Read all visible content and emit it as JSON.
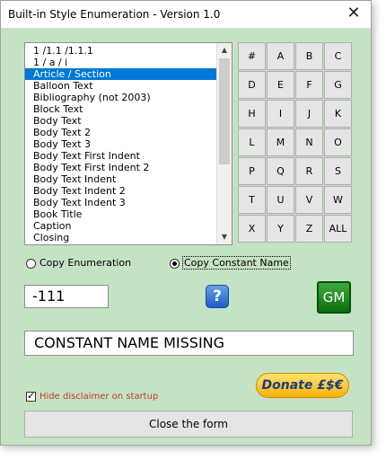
{
  "window": {
    "title": "Built-in Style Enumeration - Version 1.0",
    "close_glyph": "✕"
  },
  "style_list": {
    "items": [
      "1 /1.1 /1.1.1",
      "1 / a / i",
      "Article / Section",
      "Balloon Text",
      "Bibliography (not 2003)",
      "Block Text",
      "Body Text",
      "Body Text 2",
      "Body Text 3",
      "Body Text First Indent",
      "Body Text First Indent 2",
      "Body Text Indent",
      "Body Text Indent 2",
      "Body Text Indent 3",
      "Book Title",
      "Caption",
      "Closing"
    ],
    "selected_index": 2
  },
  "filter_keys": {
    "rows": [
      [
        "#",
        "A",
        "B",
        "C"
      ],
      [
        "D",
        "E",
        "F",
        "G"
      ],
      [
        "H",
        "I",
        "J",
        "K"
      ],
      [
        "L",
        "M",
        "N",
        "O"
      ],
      [
        "P",
        "Q",
        "R",
        "S"
      ],
      [
        "T",
        "U",
        "V",
        "W"
      ],
      [
        "X",
        "Y",
        "Z",
        "ALL"
      ]
    ]
  },
  "copy_options": {
    "enumeration_label": "Copy Enumeration",
    "constant_label": "Copy Constant Name",
    "selected": "constant"
  },
  "enum_value": "-111",
  "help_button_label": "?",
  "gm_button_label": "GM",
  "constant_name": "CONSTANT NAME MISSING",
  "donate_button_label": "Donate £$€",
  "disclaimer": {
    "label": "Hide disclaimer on startup",
    "checked": true
  },
  "close_form_label": "Close the form",
  "colors": {
    "window_bg": "#c4e2c4",
    "selection": "#0078d7",
    "disclaimer_text": "#c0392b",
    "gm_green": "#0d6e0d",
    "donate_gold": "#f7b10c"
  }
}
